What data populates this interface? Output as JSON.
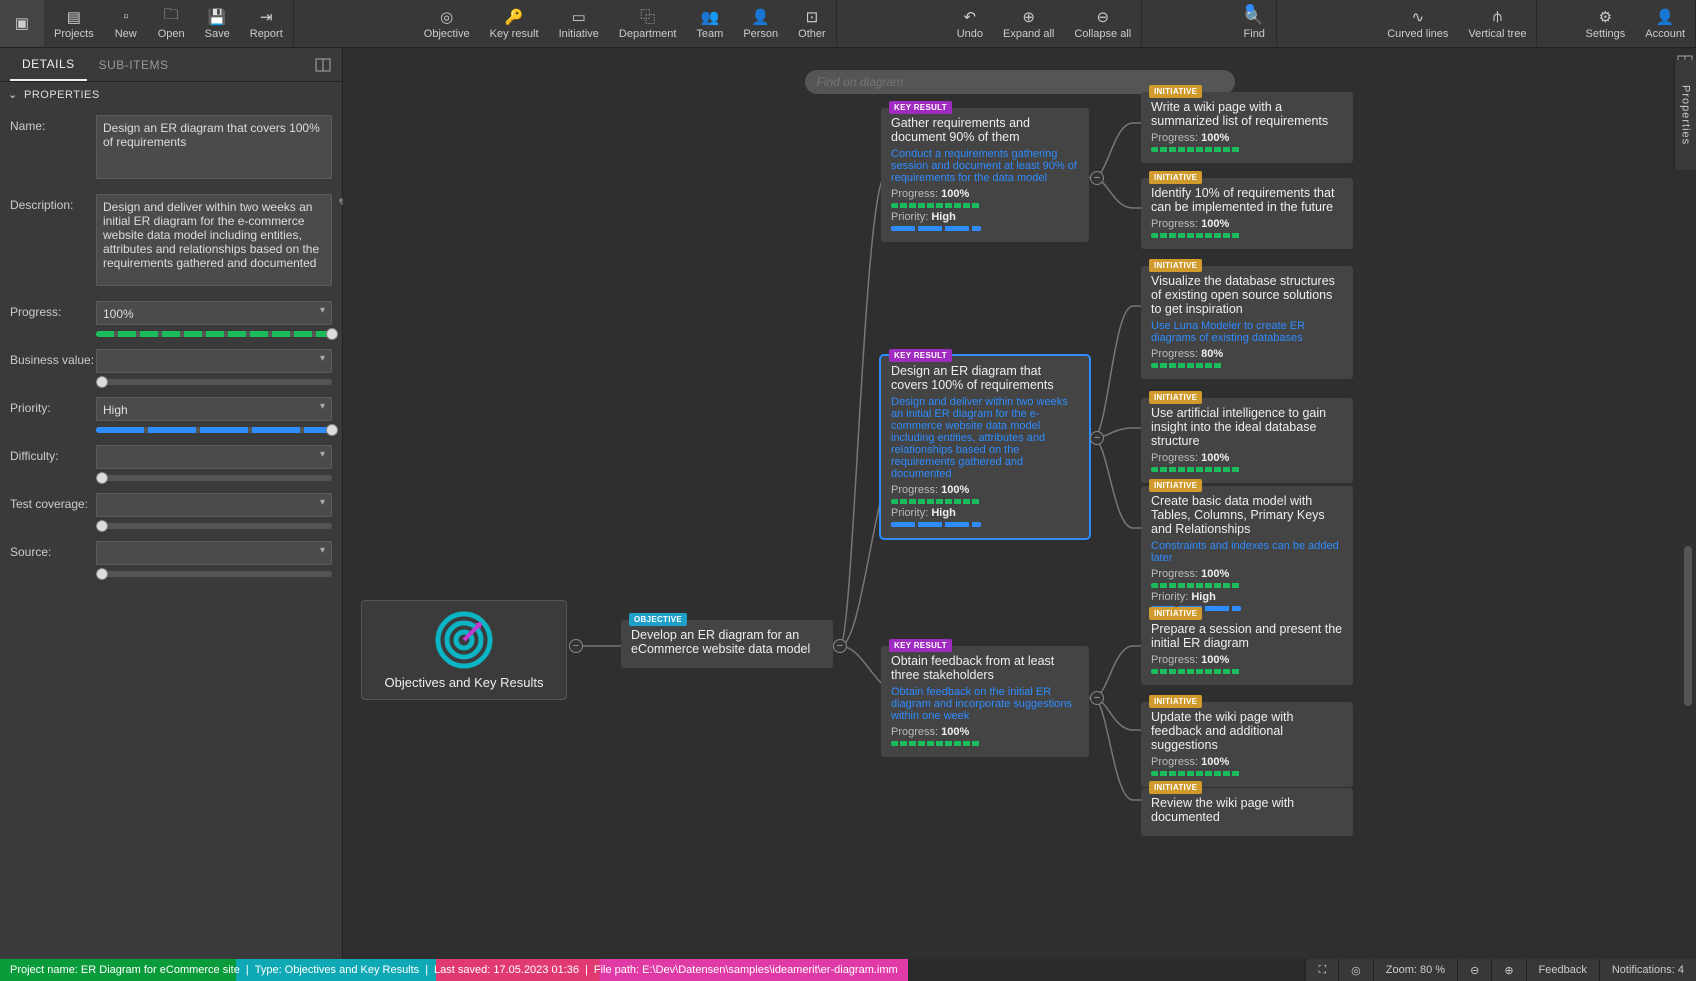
{
  "toolbar": {
    "left": [
      {
        "name": "app-icon",
        "label": "",
        "icon": "▣"
      },
      {
        "name": "projects",
        "label": "Projects",
        "icon": "▤"
      },
      {
        "name": "new",
        "label": "New",
        "icon": "▫"
      },
      {
        "name": "open",
        "label": "Open",
        "icon": "🗀"
      },
      {
        "name": "save",
        "label": "Save",
        "icon": "💾"
      },
      {
        "name": "report",
        "label": "Report",
        "icon": "⇥"
      }
    ],
    "create": [
      {
        "name": "objective",
        "label": "Objective",
        "icon": "◎"
      },
      {
        "name": "key-result",
        "label": "Key result",
        "icon": "🔑"
      },
      {
        "name": "initiative",
        "label": "Initiative",
        "icon": "▭"
      },
      {
        "name": "department",
        "label": "Department",
        "icon": "⿻"
      },
      {
        "name": "team",
        "label": "Team",
        "icon": "👥"
      },
      {
        "name": "person",
        "label": "Person",
        "icon": "👤"
      },
      {
        "name": "other",
        "label": "Other",
        "icon": "⊡"
      }
    ],
    "history": [
      {
        "name": "undo",
        "label": "Undo",
        "icon": "↶"
      },
      {
        "name": "expand-all",
        "label": "Expand all",
        "icon": "⊕"
      },
      {
        "name": "collapse-all",
        "label": "Collapse all",
        "icon": "⊖"
      }
    ],
    "find": {
      "name": "find",
      "label": "Find",
      "icon": "🔍"
    },
    "layout": [
      {
        "name": "curved-lines",
        "label": "Curved lines",
        "icon": "∿"
      },
      {
        "name": "vertical-tree",
        "label": "Vertical tree",
        "icon": "⫛"
      }
    ],
    "right": [
      {
        "name": "settings",
        "label": "Settings",
        "icon": "⚙"
      },
      {
        "name": "account",
        "label": "Account",
        "icon": "👤"
      }
    ]
  },
  "sidebar": {
    "tabs": {
      "details": "DETAILS",
      "subitems": "SUB-ITEMS"
    },
    "propsHeader": "PROPERTIES",
    "labels": {
      "name": "Name:",
      "description": "Description:",
      "progress": "Progress:",
      "business_value": "Business value:",
      "priority": "Priority:",
      "difficulty": "Difficulty:",
      "test_coverage": "Test coverage:",
      "source": "Source:"
    },
    "values": {
      "name": "Design an ER diagram that covers 100% of requirements",
      "description": "Design and deliver within two weeks an initial ER diagram for the e-commerce website data model including entities, attributes and relationships based on the requirements gathered and documented",
      "progress": "100%",
      "business_value": "",
      "priority": "High",
      "difficulty": "",
      "test_coverage": "",
      "source": ""
    }
  },
  "canvas": {
    "findPlaceholder": "Find on diagram",
    "rootTitle": "Objectives and Key Results",
    "objective": {
      "badge": "OBJECTIVE",
      "title": "Develop an ER diagram for an eCommerce website data model"
    },
    "kr1": {
      "badge": "KEY RESULT",
      "title": "Gather requirements and document 90% of them",
      "desc": "Conduct a requirements gathering session and document at least 90% of requirements for the data model",
      "progressLabel": "Progress:",
      "progress": "100%",
      "priorityLabel": "Priority:",
      "priority": "High"
    },
    "kr2": {
      "badge": "KEY RESULT",
      "title": "Design an ER diagram that covers 100% of requirements",
      "desc": "Design and deliver within two weeks an initial ER diagram for the e-commerce website data model including entities, attributes and relationships based on the requirements gathered and documented",
      "progressLabel": "Progress:",
      "progress": "100%",
      "priorityLabel": "Priority:",
      "priority": "High"
    },
    "kr3": {
      "badge": "KEY RESULT",
      "title": "Obtain feedback from at least three stakeholders",
      "desc": "Obtain feedback on the initial ER diagram and incorporate suggestions within one week",
      "progressLabel": "Progress:",
      "progress": "100%"
    },
    "ini": [
      {
        "badge": "INITIATIVE",
        "title": "Write a wiki page with a summarized list of requirements",
        "progressLabel": "Progress:",
        "progress": "100%"
      },
      {
        "badge": "INITIATIVE",
        "title": "Identify 10% of requirements that can be implemented in the future",
        "progressLabel": "Progress:",
        "progress": "100%"
      },
      {
        "badge": "INITIATIVE",
        "title": "Visualize the database structures of existing open source solutions to get inspiration",
        "desc": "Use Luna Modeler to create ER diagrams of existing databases",
        "progressLabel": "Progress:",
        "progress": "80%"
      },
      {
        "badge": "INITIATIVE",
        "title": "Use artificial intelligence to gain insight into the ideal database structure",
        "progressLabel": "Progress:",
        "progress": "100%"
      },
      {
        "badge": "INITIATIVE",
        "title": "Create basic data model with Tables, Columns, Primary Keys and Relationships",
        "desc": "Constraints and indexes can be added later",
        "progressLabel": "Progress:",
        "progress": "100%",
        "priorityLabel": "Priority:",
        "priority": "High"
      },
      {
        "badge": "INITIATIVE",
        "title": "Prepare a session and present the initial ER diagram",
        "progressLabel": "Progress:",
        "progress": "100%"
      },
      {
        "badge": "INITIATIVE",
        "title": "Update the wiki page with feedback and additional suggestions",
        "progressLabel": "Progress:",
        "progress": "100%"
      },
      {
        "badge": "INITIATIVE",
        "title": "Review the wiki page with documented"
      }
    ]
  },
  "status": {
    "project": "Project name: ER Diagram for eCommerce site",
    "type": "Type: Objectives and Key Results",
    "saved": "Last saved: 17.05.2023 01:36",
    "path": "File path: E:\\Dev\\Datensen\\samples\\ideamerit\\er-diagram.imm",
    "zoom": "Zoom: 80 %",
    "feedback": "Feedback",
    "notifications": "Notifications: 4"
  },
  "rightEdgeLabel": "Properties"
}
